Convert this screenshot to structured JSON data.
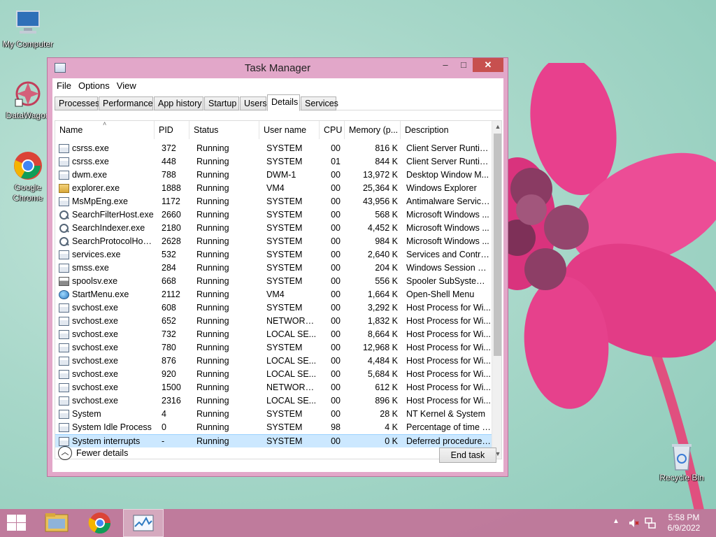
{
  "desktop": {
    "icons": [
      {
        "label": "My Computer"
      },
      {
        "label": "DataWagon"
      },
      {
        "label": "Google Chrome"
      },
      {
        "label": "Recycle Bin"
      }
    ]
  },
  "window": {
    "title": "Task Manager",
    "controls": {
      "minimize": "–",
      "maximize": "□",
      "close": "✕"
    }
  },
  "menu": {
    "file": "File",
    "options": "Options",
    "view": "View"
  },
  "tabs": [
    {
      "label": "Processes"
    },
    {
      "label": "Performance"
    },
    {
      "label": "App history"
    },
    {
      "label": "Startup"
    },
    {
      "label": "Users"
    },
    {
      "label": "Details",
      "active": true
    },
    {
      "label": "Services"
    }
  ],
  "columns": {
    "name": "Name",
    "pid": "PID",
    "status": "Status",
    "user": "User name",
    "cpu": "CPU",
    "memory": "Memory (p...",
    "description": "Description"
  },
  "processes": [
    {
      "icon": "app-icon",
      "name": "csrss.exe",
      "pid": "372",
      "status": "Running",
      "user": "SYSTEM",
      "cpu": "00",
      "memory": "816 K",
      "description": "Client Server Runtim..."
    },
    {
      "icon": "app-icon",
      "name": "csrss.exe",
      "pid": "448",
      "status": "Running",
      "user": "SYSTEM",
      "cpu": "01",
      "memory": "844 K",
      "description": "Client Server Runtim..."
    },
    {
      "icon": "app-icon",
      "name": "dwm.exe",
      "pid": "788",
      "status": "Running",
      "user": "DWM-1",
      "cpu": "00",
      "memory": "13,972 K",
      "description": "Desktop Window M..."
    },
    {
      "icon": "folder-icon",
      "name": "explorer.exe",
      "pid": "1888",
      "status": "Running",
      "user": "VM4",
      "cpu": "00",
      "memory": "25,364 K",
      "description": "Windows Explorer"
    },
    {
      "icon": "app-icon",
      "name": "MsMpEng.exe",
      "pid": "1172",
      "status": "Running",
      "user": "SYSTEM",
      "cpu": "00",
      "memory": "43,956 K",
      "description": "Antimalware Service..."
    },
    {
      "icon": "search-icon",
      "name": "SearchFilterHost.exe",
      "pid": "2660",
      "status": "Running",
      "user": "SYSTEM",
      "cpu": "00",
      "memory": "568 K",
      "description": "Microsoft Windows ..."
    },
    {
      "icon": "search-icon",
      "name": "SearchIndexer.exe",
      "pid": "2180",
      "status": "Running",
      "user": "SYSTEM",
      "cpu": "00",
      "memory": "4,452 K",
      "description": "Microsoft Windows ..."
    },
    {
      "icon": "search-icon",
      "name": "SearchProtocolHost....",
      "pid": "2628",
      "status": "Running",
      "user": "SYSTEM",
      "cpu": "00",
      "memory": "984 K",
      "description": "Microsoft Windows ..."
    },
    {
      "icon": "app-icon",
      "name": "services.exe",
      "pid": "532",
      "status": "Running",
      "user": "SYSTEM",
      "cpu": "00",
      "memory": "2,640 K",
      "description": "Services and Control..."
    },
    {
      "icon": "app-icon",
      "name": "smss.exe",
      "pid": "284",
      "status": "Running",
      "user": "SYSTEM",
      "cpu": "00",
      "memory": "204 K",
      "description": "Windows Session M..."
    },
    {
      "icon": "printer-icon",
      "name": "spoolsv.exe",
      "pid": "668",
      "status": "Running",
      "user": "SYSTEM",
      "cpu": "00",
      "memory": "556 K",
      "description": "Spooler SubSystem ..."
    },
    {
      "icon": "globe-icon",
      "name": "StartMenu.exe",
      "pid": "2112",
      "status": "Running",
      "user": "VM4",
      "cpu": "00",
      "memory": "1,664 K",
      "description": "Open-Shell Menu"
    },
    {
      "icon": "app-icon",
      "name": "svchost.exe",
      "pid": "608",
      "status": "Running",
      "user": "SYSTEM",
      "cpu": "00",
      "memory": "3,292 K",
      "description": "Host Process for Wi..."
    },
    {
      "icon": "app-icon",
      "name": "svchost.exe",
      "pid": "652",
      "status": "Running",
      "user": "NETWORK...",
      "cpu": "00",
      "memory": "1,832 K",
      "description": "Host Process for Wi..."
    },
    {
      "icon": "app-icon",
      "name": "svchost.exe",
      "pid": "732",
      "status": "Running",
      "user": "LOCAL SE...",
      "cpu": "00",
      "memory": "8,664 K",
      "description": "Host Process for Wi..."
    },
    {
      "icon": "app-icon",
      "name": "svchost.exe",
      "pid": "780",
      "status": "Running",
      "user": "SYSTEM",
      "cpu": "00",
      "memory": "12,968 K",
      "description": "Host Process for Wi..."
    },
    {
      "icon": "app-icon",
      "name": "svchost.exe",
      "pid": "876",
      "status": "Running",
      "user": "LOCAL SE...",
      "cpu": "00",
      "memory": "4,484 K",
      "description": "Host Process for Wi..."
    },
    {
      "icon": "app-icon",
      "name": "svchost.exe",
      "pid": "920",
      "status": "Running",
      "user": "LOCAL SE...",
      "cpu": "00",
      "memory": "5,684 K",
      "description": "Host Process for Wi..."
    },
    {
      "icon": "app-icon",
      "name": "svchost.exe",
      "pid": "1500",
      "status": "Running",
      "user": "NETWORK...",
      "cpu": "00",
      "memory": "612 K",
      "description": "Host Process for Wi..."
    },
    {
      "icon": "app-icon",
      "name": "svchost.exe",
      "pid": "2316",
      "status": "Running",
      "user": "LOCAL SE...",
      "cpu": "00",
      "memory": "896 K",
      "description": "Host Process for Wi..."
    },
    {
      "icon": "app-icon",
      "name": "System",
      "pid": "4",
      "status": "Running",
      "user": "SYSTEM",
      "cpu": "00",
      "memory": "28 K",
      "description": "NT Kernel & System"
    },
    {
      "icon": "app-icon",
      "name": "System Idle Process",
      "pid": "0",
      "status": "Running",
      "user": "SYSTEM",
      "cpu": "98",
      "memory": "4 K",
      "description": "Percentage of time t..."
    },
    {
      "icon": "app-icon",
      "name": "System interrupts",
      "pid": "-",
      "status": "Running",
      "user": "SYSTEM",
      "cpu": "00",
      "memory": "0 K",
      "description": "Deferred procedure ...",
      "selected": true
    }
  ],
  "footer": {
    "fewer_details": "Fewer details",
    "end_task": "End task"
  },
  "taskbar": {
    "time": "5:58 PM",
    "date": "6/9/2022"
  },
  "colors": {
    "window_frame": "#e2a7c9",
    "taskbar": "#c46e96",
    "close_button": "#c7504f",
    "selection": "#cce8ff"
  }
}
